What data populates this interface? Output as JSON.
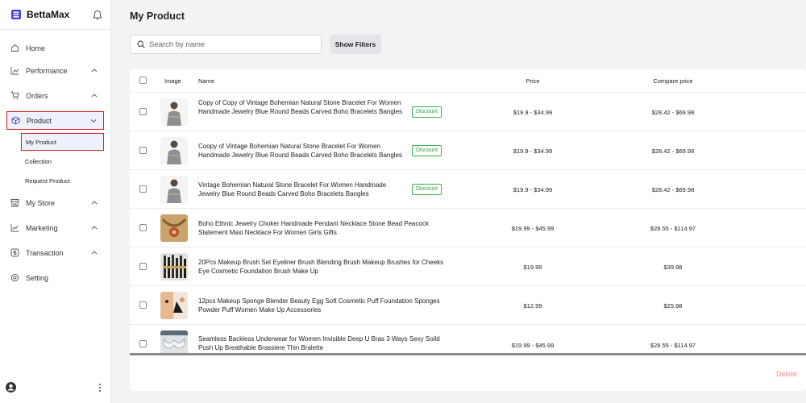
{
  "brand": {
    "name": "BettaMax"
  },
  "sidebar": {
    "items": [
      {
        "label": "Home",
        "icon": "home-icon"
      },
      {
        "label": "Performance",
        "icon": "chart-icon"
      },
      {
        "label": "Orders",
        "icon": "cart-icon"
      },
      {
        "label": "Product",
        "icon": "box-icon"
      },
      {
        "label": "My Store",
        "icon": "store-icon"
      },
      {
        "label": "Marketing",
        "icon": "megaphone-icon"
      },
      {
        "label": "Transaction",
        "icon": "dollar-icon"
      },
      {
        "label": "Setting",
        "icon": "gear-icon"
      }
    ],
    "product_sub": [
      "My Product",
      "Collection",
      "Request Product"
    ]
  },
  "page": {
    "title": "My Product"
  },
  "search": {
    "placeholder": "Search by name"
  },
  "filters": {
    "label": "Show Filters"
  },
  "table": {
    "headers": {
      "image": "Image",
      "name": "Name",
      "price": "Price",
      "compare": "Compare price"
    },
    "rows": [
      {
        "name": "Copy of Copy of Vintage Bohemian Natural Stone Bracelet For Women Handmade Jewelry Blue Round Beads Carved Boho Bracelets Bangles",
        "badge": "Discount",
        "price": "$19.9 - $34.99",
        "compare": "$28.42 - $69.98"
      },
      {
        "name": "Coopy of Vintage Bohemian Natural Stone Bracelet For Women Handmade Jewelry Blue Round Beads Carved Boho Bracelets Bangles",
        "badge": "Discount",
        "price": "$19.9 - $34.99",
        "compare": "$28.42 - $69.98"
      },
      {
        "name": "Vintage Bohemian Natural Stone Bracelet For Women Handmade Jewelry Blue Round Beads Carved Boho Bracelets Bangles",
        "badge": "Discount",
        "price": "$19.9 - $34.99",
        "compare": "$28.42 - $69.98"
      },
      {
        "name": "Boho Ethnic Jewelry Choker Handmade Pendant Necklace Stone Bead Peacock Statement Maxi Necklace For Women Girls Gifts",
        "badge": "",
        "price": "$19.99 - $45.99",
        "compare": "$28.55 - $114.97"
      },
      {
        "name": "20Pcs Makeup Brush Set Eyeliner Brush Blending Brush Makeup Brushes for Cheeks Eye Cosmetic Foundation Brush Make Up",
        "badge": "",
        "price": "$19.99",
        "compare": "$39.98"
      },
      {
        "name": "12pcs Makeup Sponge Blender Beauty Egg Soft Cosmetic Puff Foundation Sponges Powder Puff Women Make Up Accessories",
        "badge": "",
        "price": "$12.99",
        "compare": "$25.98"
      },
      {
        "name": "Seamless Backless Underwear for Women Invisible Deep U Bras 3 Ways Sexy Soild Push Up Breathable Brassiere Thin Bralette",
        "badge": "",
        "price": "$19.99 - $45.99",
        "compare": "$28.55 - $114.97"
      }
    ]
  },
  "actions": {
    "delete": "Delete"
  },
  "colors": {
    "accent": "#4a3fd6",
    "active_border": "#d32020",
    "badge_green": "#2f9e44",
    "delete": "#f08c8c"
  }
}
